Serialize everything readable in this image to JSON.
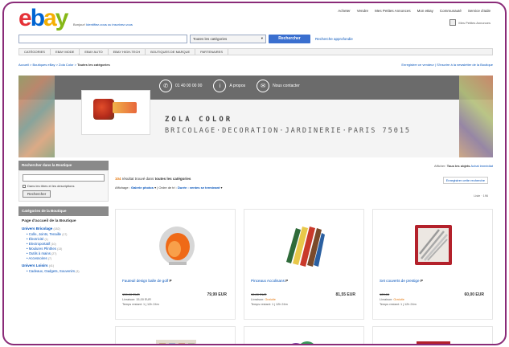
{
  "header": {
    "logo": [
      "e",
      "b",
      "a",
      "y"
    ],
    "greeting": "Bonjour!",
    "greeting_link": "Identifiez-vous ou inscrivez-vous",
    "topnav": [
      "Acheter",
      "Vendre",
      "Mes Petites Annonces",
      "Mon eBay",
      "Communauté",
      "Service d'aide"
    ],
    "account": "Mes Petites Annonces"
  },
  "search": {
    "placeholder": "",
    "category": "Toutes les catégories",
    "button": "Rechercher",
    "advanced": "Recherche approfondie"
  },
  "catbar": [
    "CATÉGORIES",
    "EBAY MODE",
    "EBAY AUTO",
    "EBAY HIGH-TECH",
    "BOUTIQUES DE MARQUE",
    "PARTENAIRES"
  ],
  "breadcrumb": {
    "path": "Accueil > Boutiques eBay > Zola Color >",
    "current": "Toutes les catégories"
  },
  "save_seller": "Enregistrer ce vendeur | S'inscrire à la newsletter de la Boutique",
  "banner": {
    "links": [
      {
        "icon": "phone-icon",
        "glyph": "✆",
        "label": "01 40 00 00 00"
      },
      {
        "icon": "info-icon",
        "glyph": "i",
        "label": "A propos"
      },
      {
        "icon": "mail-icon",
        "glyph": "✉",
        "label": "Nous contacter"
      }
    ],
    "store_name": "ZOLA COLOR",
    "tagline": "BRICOLAGE·DECORATION·JARDINERIE·PARIS 75015"
  },
  "sidebar": {
    "search_head": "Rechercher dans la Boutique",
    "check_label": "Dans les titres et les descriptions",
    "search_button": "Rechercher",
    "cats_head": "Catégories de la Boutique",
    "home": "Page d'accueil de la Boutique",
    "groups": [
      {
        "label": "Univers Bricolage",
        "count": "(182)",
        "items": [
          {
            "label": "Colle, Joints, Tenaille",
            "count": "(17)"
          },
          {
            "label": "Électricité",
            "count": "(1)"
          },
          {
            "label": "Electroportatif",
            "count": "(10)"
          },
          {
            "label": "Moulures Plinthes",
            "count": "(13)"
          },
          {
            "label": "Outils à mains",
            "count": "(27)"
          },
          {
            "label": "Accessoires",
            "count": "(7)"
          }
        ]
      },
      {
        "label": "Univers Loisirs",
        "count": "(41)",
        "items": [
          {
            "label": "Cadeaux, Gadgets, Souvenirs",
            "count": "(3)"
          }
        ]
      }
    ]
  },
  "main": {
    "view_label": "Afficher:",
    "view_all": "Tous les objets",
    "view_auction": "Achat immédiat",
    "count": "104",
    "count_text": "résultat trouvé dans",
    "count_scope": "toutes les catégories",
    "save_search": "Enregistrer cette recherche",
    "sort_label": "Affichage :",
    "sort_view": "Galerie photos",
    "sort_order_label": "Ordre de tri :",
    "sort_order": "Durée : ventes se terminant",
    "list_view": "Liste · 196",
    "items": [
      {
        "title": "Fauteuil design balle de golf",
        "old_price": "139,90 EUR",
        "sale": "",
        "price": "79,99 EUR",
        "ship": "Livraison: 15,00 EUR",
        "time": "Temps restant: 1 j 12h 24m",
        "thumb": "orange-chair"
      },
      {
        "title": "Pinceaux Accolisans",
        "old_price": "15,00 EUR",
        "sale": "",
        "price": "81,55 EUR",
        "ship": "Livraison:",
        "ship_free": "Gratuite",
        "time": "Temps restant: 1 j 12h 24m",
        "thumb": "brushes"
      },
      {
        "title": "Set couverts de prestige",
        "old_price": "120,00",
        "sale": "",
        "price": "60,00 EUR",
        "ship": "Livraison:",
        "ship_free": "Gratuite",
        "time": "Temps restant: 1 j 12h 24m",
        "thumb": "cutlery"
      },
      {
        "title": "",
        "thumb": "placeholder-1"
      },
      {
        "title": "",
        "thumb": "placeholder-2"
      },
      {
        "title": "",
        "thumb": "placeholder-3"
      }
    ]
  }
}
